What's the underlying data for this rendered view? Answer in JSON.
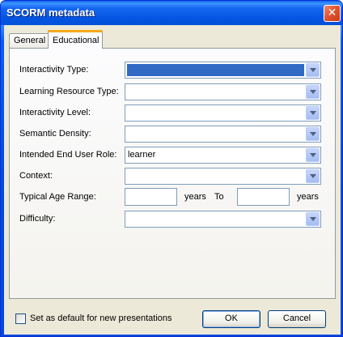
{
  "window": {
    "title": "SCORM metadata"
  },
  "tabs": [
    {
      "label": "General",
      "active": false
    },
    {
      "label": "Educational",
      "active": true
    }
  ],
  "form": {
    "interactivity_type": {
      "label": "Interactivity Type:",
      "value": ""
    },
    "learning_resource_type": {
      "label": "Learning Resource Type:",
      "value": ""
    },
    "interactivity_level": {
      "label": "Interactivity Level:",
      "value": ""
    },
    "semantic_density": {
      "label": "Semantic Density:",
      "value": ""
    },
    "intended_end_user_role": {
      "label": "Intended End User Role:",
      "value": "learner"
    },
    "context": {
      "label": "Context:",
      "value": ""
    },
    "typical_age_range": {
      "label": "Typical Age Range:",
      "from_value": "",
      "years_label_1": "years",
      "to_label": "To",
      "to_value": "",
      "years_label_2": "years"
    },
    "difficulty": {
      "label": "Difficulty:",
      "value": ""
    }
  },
  "footer": {
    "default_checkbox": {
      "label": "Set as default for new presentations",
      "checked": false
    },
    "ok_label": "OK",
    "cancel_label": "Cancel"
  },
  "icons": {
    "close": "close-icon",
    "dropdown": "chevron-down-icon"
  },
  "colors": {
    "selection": "#316ac5",
    "tab_highlight": "#f7a91a",
    "titlebar": "#0555e2"
  }
}
